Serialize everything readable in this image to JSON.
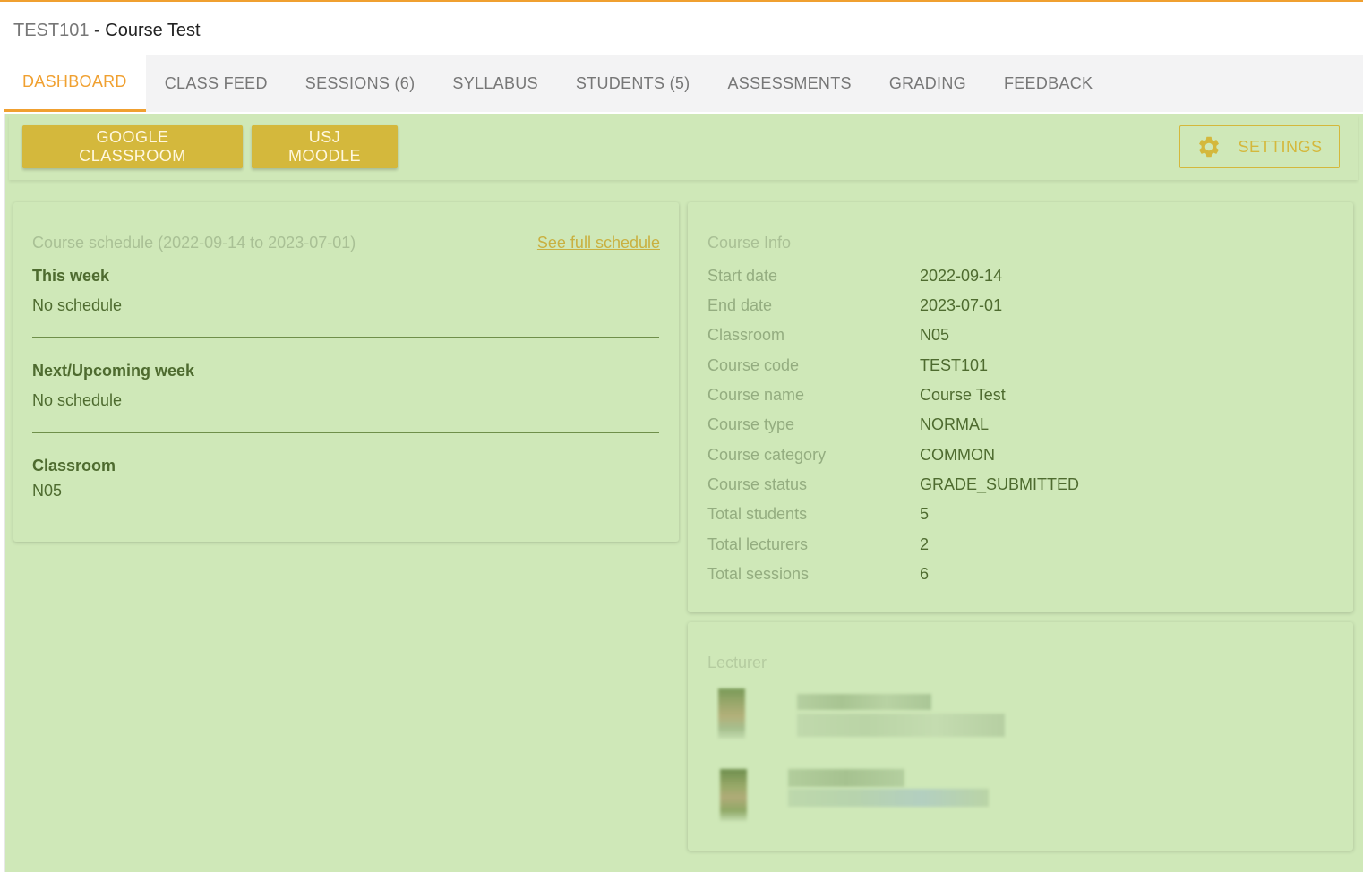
{
  "header": {
    "code": "TEST101",
    "separator": " - ",
    "name": "Course Test"
  },
  "tabs": [
    "DASHBOARD",
    "CLASS FEED",
    "SESSIONS (6)",
    "SYLLABUS",
    "STUDENTS (5)",
    "ASSESSMENTS",
    "GRADING",
    "FEEDBACK"
  ],
  "toolbar": {
    "google_label": "GOOGLE CLASSROOM",
    "moodle_label": "USJ MOODLE",
    "settings_label": "SETTINGS",
    "settings_icon": "gear-icon"
  },
  "schedule": {
    "title": "Course schedule (2022-09-14 to 2023-07-01)",
    "link": "See full schedule",
    "this_week_label": "This week",
    "this_week_value": "No schedule",
    "next_week_label": "Next/Upcoming week",
    "next_week_value": "No schedule",
    "classroom_label": "Classroom",
    "classroom_value": "N05"
  },
  "course_info": {
    "title": "Course Info",
    "rows": [
      {
        "label": "Start date",
        "value": "2022-09-14"
      },
      {
        "label": "End date",
        "value": "2023-07-01"
      },
      {
        "label": "Classroom",
        "value": "N05"
      },
      {
        "label": "Course code",
        "value": "TEST101"
      },
      {
        "label": "Course name",
        "value": "Course Test"
      },
      {
        "label": "Course type",
        "value": "NORMAL"
      },
      {
        "label": "Course category",
        "value": "COMMON"
      },
      {
        "label": "Course status",
        "value": "GRADE_SUBMITTED"
      },
      {
        "label": "Total students",
        "value": "5"
      },
      {
        "label": "Total lecturers",
        "value": "2"
      },
      {
        "label": "Total sessions",
        "value": "6"
      }
    ]
  },
  "lecturer": {
    "title": "Lecturer"
  },
  "colors": {
    "accent": "#f0a030",
    "button": "#d4b83c",
    "panel": "#cfe8b8",
    "text_green": "#4e6b2f"
  }
}
